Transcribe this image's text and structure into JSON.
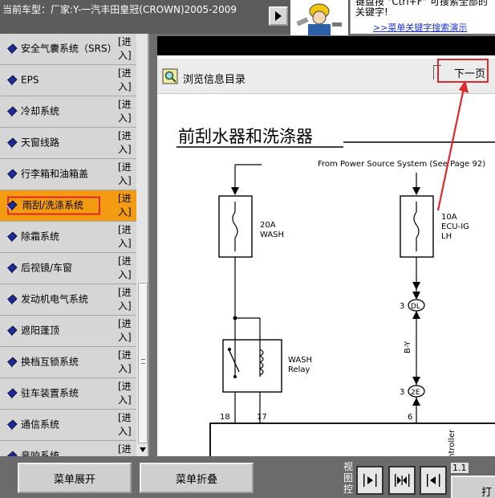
{
  "header": {
    "vehicle_label": "当前车型：厂家:Y-一汽丰田皇冠(CROWN)2005-2009",
    "tip_text": "键盘按 \"Ctrl+F\" 可搜索全部的关键字!",
    "tip_link": ">>菜单关键字搜索演示"
  },
  "menu": {
    "items": [
      {
        "label": "安全气囊系统（SRS）",
        "enter": "[进入]"
      },
      {
        "label": "EPS",
        "enter": "[进入]"
      },
      {
        "label": "冷却系统",
        "enter": "[进入]"
      },
      {
        "label": "天窗线路",
        "enter": "[进入]"
      },
      {
        "label": "行李箱和油箱盖",
        "enter": "[进入]"
      },
      {
        "label": "雨刮/洗涤系统",
        "enter": "[进入]"
      },
      {
        "label": "除霜系统",
        "enter": "[进入]"
      },
      {
        "label": "后视镜/车窗",
        "enter": "[进入]"
      },
      {
        "label": "发动机电气系统",
        "enter": "[进入]"
      },
      {
        "label": "遮阳蓬顶",
        "enter": "[进入]"
      },
      {
        "label": "换档互锁系统",
        "enter": "[进入]"
      },
      {
        "label": "驻车装置系统",
        "enter": "[进入]"
      },
      {
        "label": "通信系统",
        "enter": "[进入]"
      },
      {
        "label": "音响系统",
        "enter": "[进入]"
      }
    ],
    "active_index": 5
  },
  "viewer": {
    "browse_label": "浏览信息目录",
    "next_label": "下一页"
  },
  "diagram": {
    "title": "前刮水器和洗涤器",
    "source_note": "From Power Source System (See Page 92)",
    "fuse1_label_line1": "20A",
    "fuse1_label_line2": "WASH",
    "fuse2_label_line1": "10A",
    "fuse2_label_line2": "ECU-IG",
    "fuse2_label_line3": "LH",
    "relay_label_line1": "WASH",
    "relay_label_line2": "Relay",
    "connector1_pin": "3",
    "connector1_id": "DL",
    "connector2_pin": "3",
    "connector2_id": "2E",
    "wire_color": "B-Y",
    "pin_18": "18",
    "pin_17": "17",
    "pin_6": "6",
    "box_label": "ontroller"
  },
  "bottom": {
    "expand_label": "菜单展开",
    "collapse_label": "菜单折叠",
    "view_ctrl_label": "视图控",
    "zoom_value": "1.1",
    "print_label": "打印"
  },
  "colors": {
    "active_item_bg": "#f39c12",
    "highlight_red": "#e0272a",
    "link_blue": "#1a2fd0"
  }
}
